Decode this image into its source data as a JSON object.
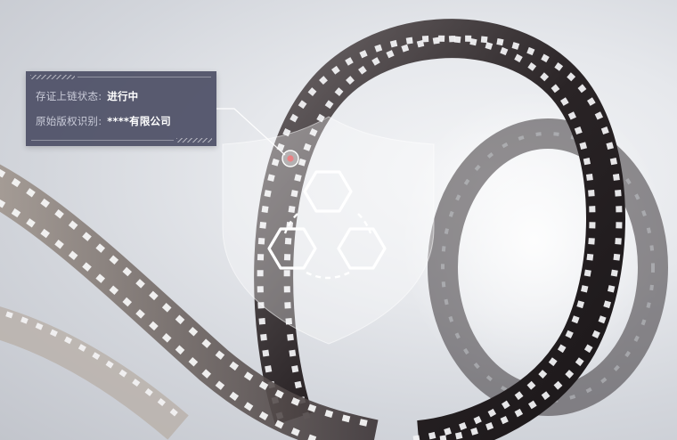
{
  "info_card": {
    "status_label": "存证上链状态:",
    "status_value": "进行中",
    "owner_label": "原始版权识别:",
    "owner_value": "****有限公司"
  },
  "colors": {
    "card_bg": "#4e5066",
    "marker_red": "#e0474c",
    "icon_stroke": "#ffffff"
  },
  "icons": {
    "shield": "shield-icon",
    "hexagon_network": "hexagon-network-icon"
  }
}
